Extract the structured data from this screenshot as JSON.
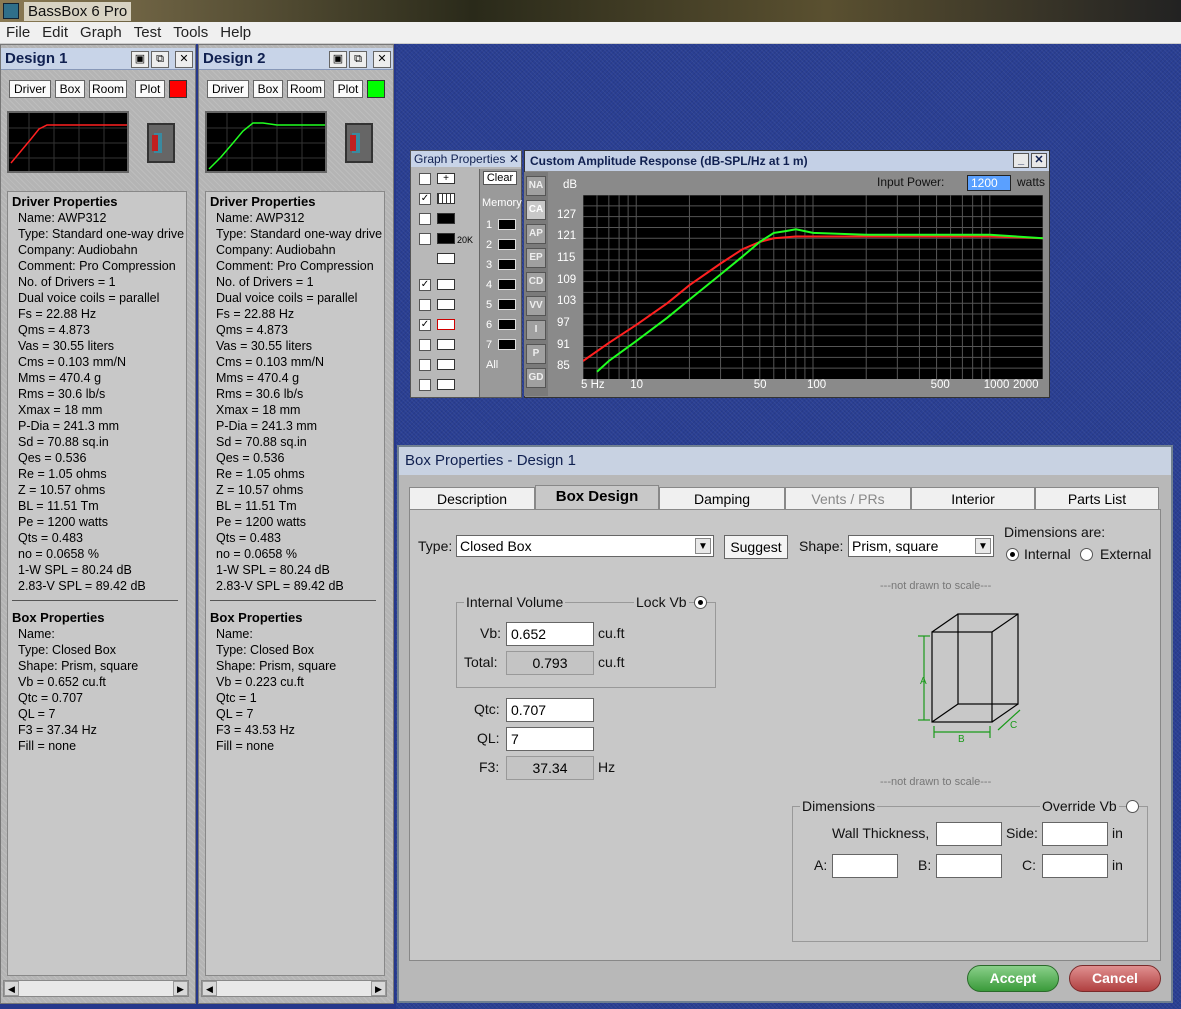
{
  "app": {
    "title": "BassBox 6 Pro"
  },
  "menu": [
    "File",
    "Edit",
    "Graph",
    "Test",
    "Tools",
    "Help"
  ],
  "designs": [
    {
      "title": "Design 1",
      "tabs": [
        "Driver",
        "Box",
        "Room",
        "Plot"
      ],
      "plot_color": "#ff0000",
      "driver_header": "Driver Properties",
      "driver": [
        "Name: AWP312",
        "Type: Standard one-way drive",
        "Company: Audiobahn",
        "Comment: Pro Compression",
        "No. of Drivers = 1",
        "Dual voice coils = parallel",
        "Fs = 22.88 Hz",
        "Qms = 4.873",
        "Vas = 30.55 liters",
        "Cms = 0.103 mm/N",
        "Mms = 470.4 g",
        "Rms = 30.6 lb/s",
        "Xmax = 18 mm",
        "P-Dia = 241.3 mm",
        "Sd = 70.88 sq.in",
        "Qes = 0.536",
        "Re = 1.05 ohms",
        "Z = 10.57 ohms",
        "BL = 11.51 Tm",
        "Pe = 1200 watts",
        "Qts = 0.483",
        "no = 0.0658 %",
        "1-W SPL = 80.24 dB",
        "2.83-V SPL = 89.42 dB"
      ],
      "box_header": "Box Properties",
      "box": [
        "Name:",
        "Type: Closed Box",
        "Shape: Prism, square",
        "Vb = 0.652 cu.ft",
        "Qtc = 0.707",
        "QL = 7",
        "F3 = 37.34 Hz",
        "Fill = none"
      ]
    },
    {
      "title": "Design 2",
      "tabs": [
        "Driver",
        "Box",
        "Room",
        "Plot"
      ],
      "plot_color": "#00ff00",
      "driver_header": "Driver Properties",
      "driver": [
        "Name: AWP312",
        "Type: Standard one-way drive",
        "Company: Audiobahn",
        "Comment: Pro Compression",
        "No. of Drivers = 1",
        "Dual voice coils = parallel",
        "Fs = 22.88 Hz",
        "Qms = 4.873",
        "Vas = 30.55 liters",
        "Cms = 0.103 mm/N",
        "Mms = 470.4 g",
        "Rms = 30.6 lb/s",
        "Xmax = 18 mm",
        "P-Dia = 241.3 mm",
        "Sd = 70.88 sq.in",
        "Qes = 0.536",
        "Re = 1.05 ohms",
        "Z = 10.57 ohms",
        "BL = 11.51 Tm",
        "Pe = 1200 watts",
        "Qts = 0.483",
        "no = 0.0658 %",
        "1-W SPL = 80.24 dB",
        "2.83-V SPL = 89.42 dB"
      ],
      "box_header": "Box Properties",
      "box": [
        "Name:",
        "Type: Closed Box",
        "Shape: Prism, square",
        "Vb = 0.223 cu.ft",
        "Qtc = 1",
        "QL = 7",
        "F3 = 43.53 Hz",
        "Fill = none"
      ]
    }
  ],
  "graph_props": {
    "title": "Graph Properties",
    "clear": "Clear",
    "memory": "Memory",
    "slots": [
      "1",
      "2",
      "3",
      "4",
      "5",
      "6",
      "7"
    ],
    "all": "All",
    "icon20k": "20K"
  },
  "side_buttons": [
    "NA",
    "CA",
    "AP",
    "EP",
    "CD",
    "VV",
    "I",
    "P",
    "GD"
  ],
  "chart": {
    "title": "Custom Amplitude Response (dB-SPL/Hz at 1 m)",
    "input_power_label": "Input Power:",
    "input_power": "1200",
    "input_power_unit": "watts",
    "yunit": "dB",
    "yticks": [
      "127",
      "121",
      "115",
      "109",
      "103",
      "97",
      "91",
      "85"
    ],
    "xticks": [
      "5 Hz",
      "10",
      "50",
      "100",
      "500",
      "1000",
      "2000"
    ]
  },
  "chart_data": {
    "type": "line",
    "title": "Custom Amplitude Response (dB-SPL/Hz at 1 m)",
    "xlabel": "",
    "ylabel": "dB",
    "xscale": "log",
    "xlim": [
      5,
      2000
    ],
    "ylim": [
      82,
      133
    ],
    "grid": true,
    "series": [
      {
        "color": "#ff2020",
        "x": [
          5,
          7,
          10,
          15,
          20,
          30,
          40,
          50,
          60,
          80,
          100,
          200,
          500,
          1000,
          2000
        ],
        "y": [
          87,
          92,
          97,
          103,
          108,
          114,
          118,
          120,
          121,
          121.5,
          121.5,
          121.5,
          121.5,
          121.5,
          121
        ]
      },
      {
        "color": "#20ff20",
        "x": [
          6,
          7,
          10,
          15,
          20,
          30,
          40,
          50,
          60,
          70,
          80,
          100,
          200,
          500,
          1000,
          2000
        ],
        "y": [
          84,
          87,
          92.5,
          99,
          104,
          111,
          116,
          120,
          122.5,
          123,
          123.5,
          122.5,
          122,
          122,
          122,
          121
        ]
      }
    ]
  },
  "box_props": {
    "title": "Box Properties - Design 1",
    "tabs": [
      "Description",
      "Box Design",
      "Damping",
      "Vents / PRs",
      "Interior",
      "Parts List"
    ],
    "type_label": "Type:",
    "type_value": "Closed Box",
    "suggest": "Suggest",
    "shape_label": "Shape:",
    "shape_value": "Prism, square",
    "dims_are": "Dimensions are:",
    "internal": "Internal",
    "external": "External",
    "iv_group": "Internal Volume",
    "lock_vb": "Lock Vb",
    "vb_label": "Vb:",
    "vb": "0.652",
    "vb_unit": "cu.ft",
    "total_label": "Total:",
    "total": "0.793",
    "total_unit": "cu.ft",
    "qtc_label": "Qtc:",
    "qtc": "0.707",
    "ql_label": "QL:",
    "ql": "7",
    "f3_label": "F3:",
    "f3": "37.34",
    "f3_unit": "Hz",
    "not_drawn": "---not drawn to scale---",
    "dim_a": "A",
    "dim_b": "B",
    "dim_c": "C",
    "dims_group": "Dimensions",
    "override_vb": "Override Vb",
    "wall": "Wall Thickness,",
    "side": "Side:",
    "in": "in",
    "a": "A:",
    "b": "B:",
    "c": "C:",
    "accept": "Accept",
    "cancel": "Cancel"
  }
}
